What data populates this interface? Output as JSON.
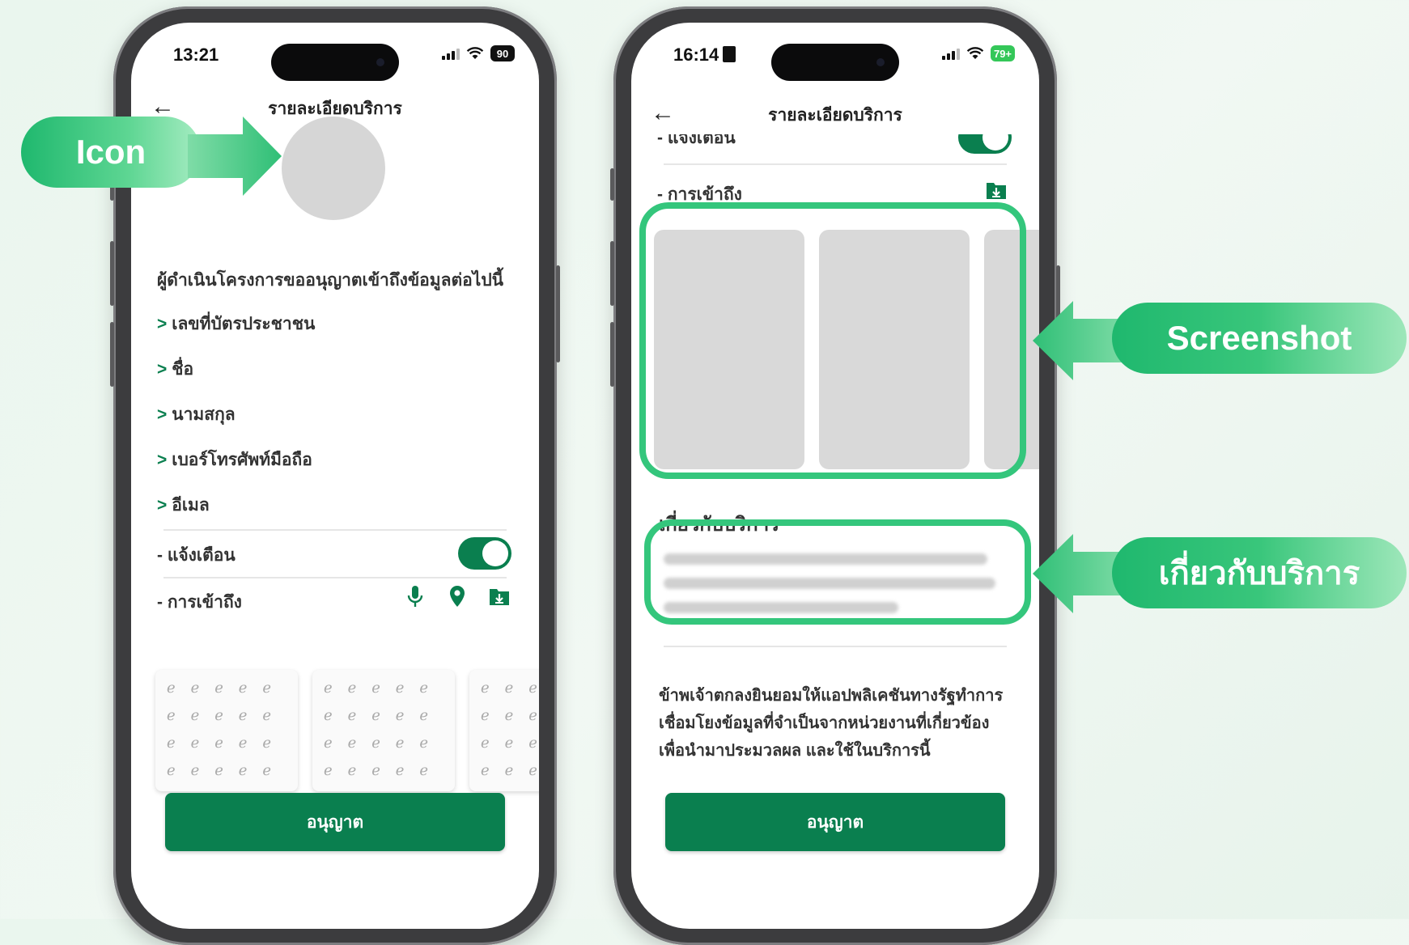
{
  "colors": {
    "accent": "#0a7f4f",
    "callout": "#34c67c",
    "placeholder": "#d6d6d6"
  },
  "left_phone": {
    "status": {
      "time": "13:21",
      "battery": "90"
    },
    "nav": {
      "back_icon": "arrow-left-icon",
      "title": "รายละเอียดบริการ"
    },
    "request_text": "ผู้ดำเนินโครงการขออนุญาตเข้าถึงข้อมูลต่อไปนี้",
    "permissions": [
      {
        "marker": ">",
        "label": "เลขที่บัตรประชาชน"
      },
      {
        "marker": ">",
        "label": "ชื่อ"
      },
      {
        "marker": ">",
        "label": "นามสกุล"
      },
      {
        "marker": ">",
        "label": "เบอร์โทรศัพท์มือถือ"
      },
      {
        "marker": ">",
        "label": "อีเมล"
      }
    ],
    "notify_label": "- แจ้งเตือน",
    "notify_on": true,
    "access_label": "- การเข้าถึง",
    "access_icons": [
      "microphone-icon",
      "location-pin-icon",
      "download-folder-icon"
    ],
    "allow_button": "อนุญาต"
  },
  "right_phone": {
    "status": {
      "time": "16:14",
      "battery": "79+"
    },
    "nav": {
      "back_icon": "arrow-left-icon",
      "title": "รายละเอียดบริการ"
    },
    "notify_label_partial": "- แจ้งเตือน",
    "access_label": "- การเข้าถึง",
    "about_title": "เกี่ยวกับบริการ",
    "about_arrow_icon": "arrow-right-icon",
    "consent_lines": [
      "ข้าพเจ้าตกลงยินยอมให้แอปพลิเคชันทางรัฐทำการ",
      "เชื่อมโยงข้อมูลที่จำเป็นจากหน่วยงานที่เกี่ยวข้อง",
      "เพื่อนำมาประมวลผล และใช้ในบริการนี้"
    ],
    "allow_button": "อนุญาต"
  },
  "callouts": {
    "icon": "Icon",
    "screenshot": "Screenshot",
    "about": "เกี่ยวกับบริการ"
  }
}
